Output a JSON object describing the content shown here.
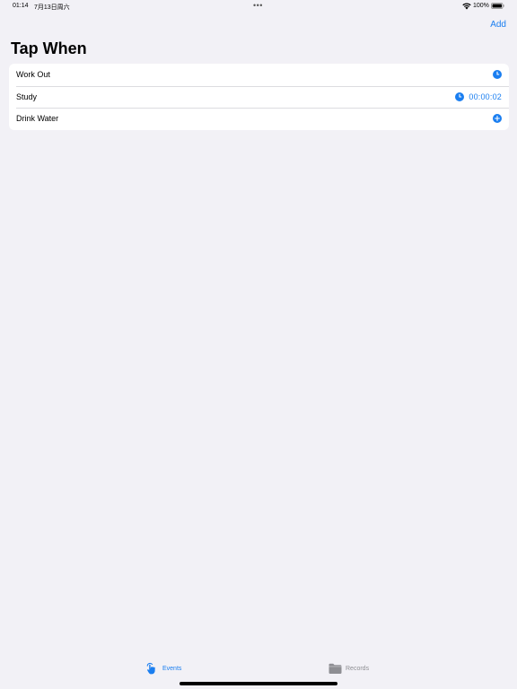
{
  "status_bar": {
    "time": "01:14",
    "date": "7月13日周六",
    "battery": "100%"
  },
  "nav": {
    "add_label": "Add",
    "title": "Tap When"
  },
  "events": [
    {
      "name": "Work Out",
      "timer": "",
      "icon": "clock-icon"
    },
    {
      "name": "Study",
      "timer": "00:00:02",
      "icon": "clock-icon"
    },
    {
      "name": "Drink Water",
      "timer": "",
      "icon": "plus-circle-icon"
    }
  ],
  "tabs": [
    {
      "label": "Events",
      "icon": "tap-hand-icon",
      "active": true
    },
    {
      "label": "Records",
      "icon": "folder-icon",
      "active": false
    }
  ],
  "colors": {
    "accent": "#1a7ef0",
    "background": "#f2f1f6",
    "inactive": "#8e8e93"
  }
}
